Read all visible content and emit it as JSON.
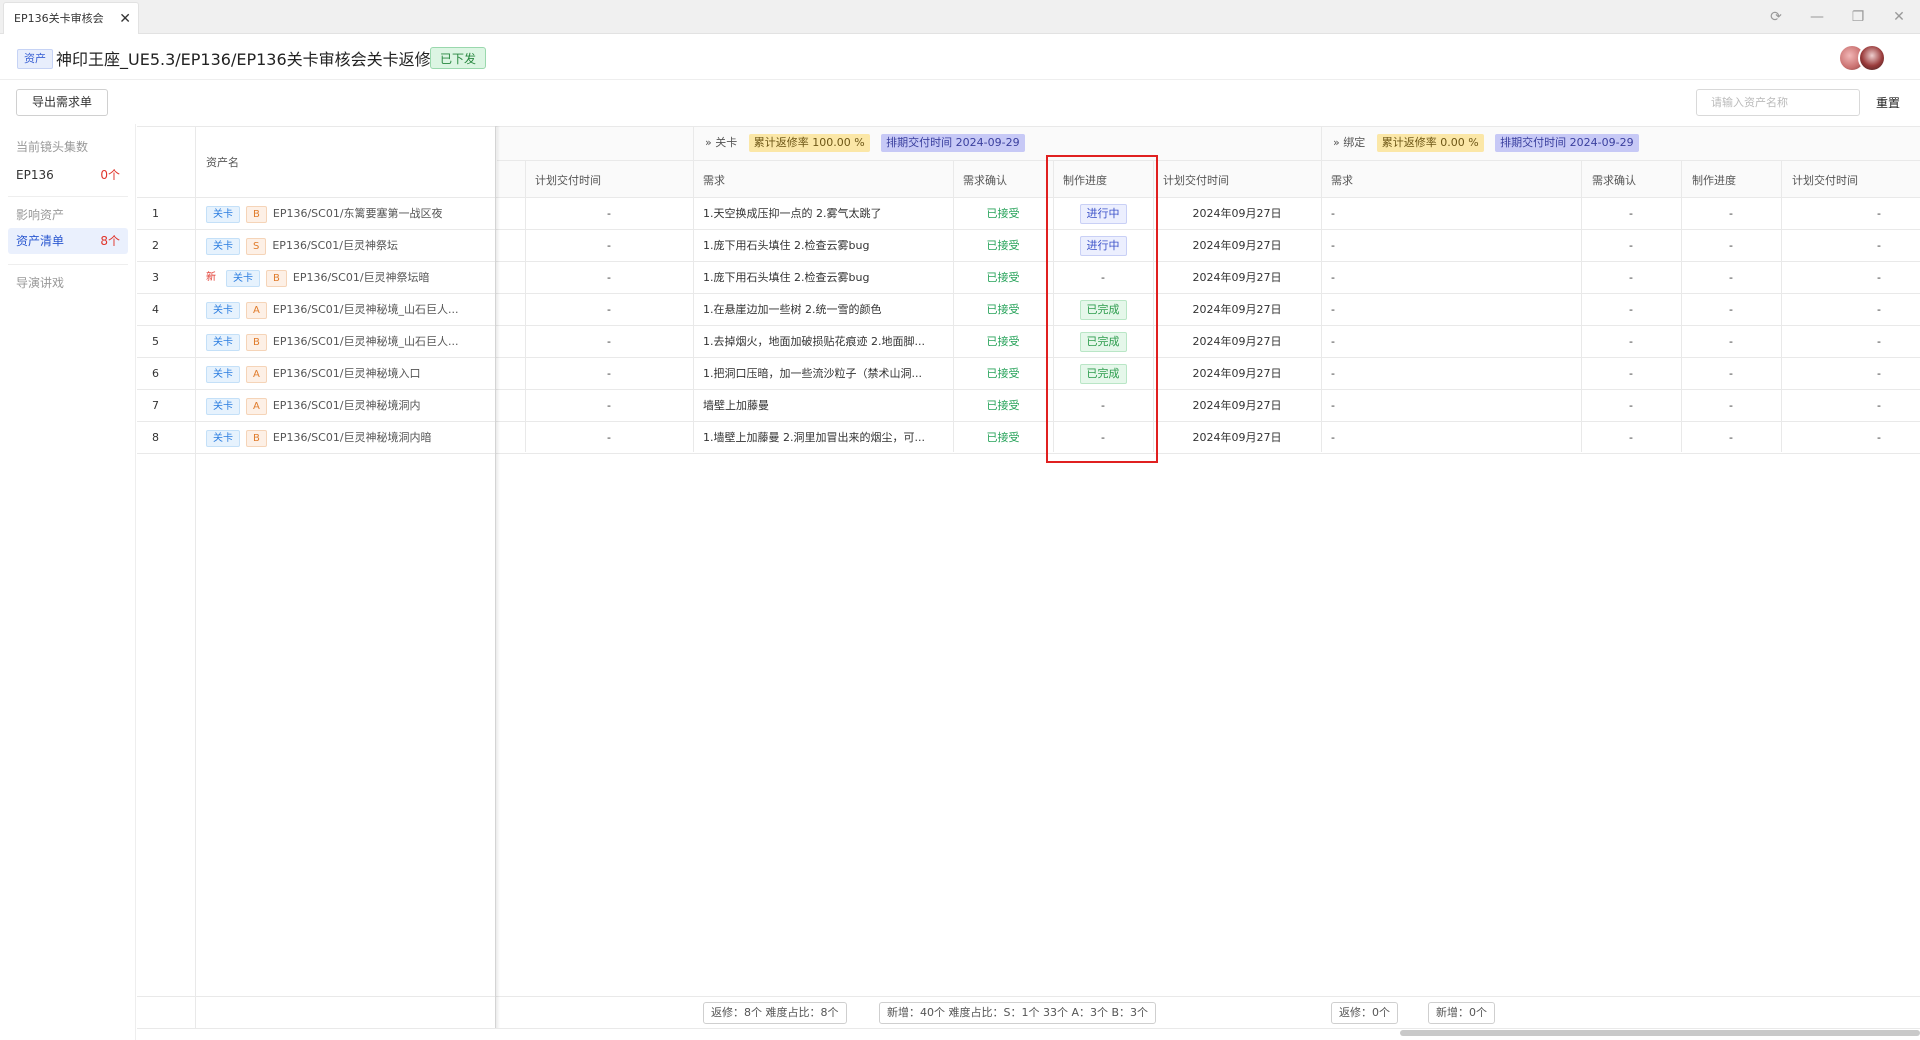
{
  "tab": {
    "label": "EP136关卡审核会",
    "close": "✕"
  },
  "window": {
    "refresh": "⟳",
    "minimize": "—",
    "restore": "❐",
    "close": "✕"
  },
  "header": {
    "asset_tag": "资产",
    "title": "神印王座_UE5.3/EP136/EP136关卡审核会关卡返修",
    "status": "已下发"
  },
  "toolbar": {
    "export_label": "导出需求单",
    "search_placeholder": "请输入资产名称",
    "reset_label": "重置"
  },
  "sidebar": {
    "group1_label": "当前镜头集数",
    "episode": {
      "label": "EP136",
      "count": "0个"
    },
    "group2_label": "影响资产",
    "asset_list": {
      "label": "资产清单",
      "count": "8个"
    },
    "group3_label": "导演讲戏"
  },
  "table": {
    "asset_name_header": "资产名",
    "plan_time_header": "计划交付时间",
    "section_level": {
      "name": "关卡",
      "rate": "累计返修率 100.00 %",
      "schedule": "排期交付时间 2024-09-29",
      "col_requirement": "需求",
      "col_confirm": "需求确认",
      "col_progress": "制作进度",
      "col_plan_time": "计划交付时间"
    },
    "section_binding": {
      "name": "绑定",
      "rate": "累计返修率 0.00 %",
      "schedule": "排期交付时间 2024-09-29",
      "col_requirement": "需求",
      "col_confirm": "需求确认",
      "col_progress": "制作进度",
      "col_plan_time": "计划交付时间"
    },
    "rows": [
      {
        "index": "1",
        "is_new": "",
        "type": "关卡",
        "grade": "B",
        "path": "EP136/SC01/东篱要塞第一战区夜",
        "prev_plan": "-",
        "requirement": "1.天空换成压抑一点的 2.雾气太跳了",
        "confirm": "已接受",
        "progress": "进行中",
        "plan_time": "2024年09月27日",
        "b_req": "-",
        "b_confirm": "-",
        "b_progress": "-",
        "b_plan": "-"
      },
      {
        "index": "2",
        "is_new": "",
        "type": "关卡",
        "grade": "S",
        "path": "EP136/SC01/巨灵神祭坛",
        "prev_plan": "-",
        "requirement": "1.庞下用石头填住 2.检查云雾bug",
        "confirm": "已接受",
        "progress": "进行中",
        "plan_time": "2024年09月27日",
        "b_req": "-",
        "b_confirm": "-",
        "b_progress": "-",
        "b_plan": "-"
      },
      {
        "index": "3",
        "is_new": "新",
        "type": "关卡",
        "grade": "B",
        "path": "EP136/SC01/巨灵神祭坛暗",
        "prev_plan": "-",
        "requirement": "1.庞下用石头填住 2.检查云雾bug",
        "confirm": "已接受",
        "progress": "-",
        "plan_time": "2024年09月27日",
        "b_req": "-",
        "b_confirm": "-",
        "b_progress": "-",
        "b_plan": "-"
      },
      {
        "index": "4",
        "is_new": "",
        "type": "关卡",
        "grade": "A",
        "path": "EP136/SC01/巨灵神秘境_山石巨人...",
        "prev_plan": "-",
        "requirement": "1.在悬崖边加一些树 2.统一雪的颜色",
        "confirm": "已接受",
        "progress": "已完成",
        "plan_time": "2024年09月27日",
        "b_req": "-",
        "b_confirm": "-",
        "b_progress": "-",
        "b_plan": "-"
      },
      {
        "index": "5",
        "is_new": "",
        "type": "关卡",
        "grade": "B",
        "path": "EP136/SC01/巨灵神秘境_山石巨人...",
        "prev_plan": "-",
        "requirement": "1.去掉烟火，地面加破损贴花痕迹 2.地面脚...",
        "confirm": "已接受",
        "progress": "已完成",
        "plan_time": "2024年09月27日",
        "b_req": "-",
        "b_confirm": "-",
        "b_progress": "-",
        "b_plan": "-"
      },
      {
        "index": "6",
        "is_new": "",
        "type": "关卡",
        "grade": "A",
        "path": "EP136/SC01/巨灵神秘境入口",
        "prev_plan": "-",
        "requirement": "1.把洞口压暗，加一些流沙粒子（禁术山洞...",
        "confirm": "已接受",
        "progress": "已完成",
        "plan_time": "2024年09月27日",
        "b_req": "-",
        "b_confirm": "-",
        "b_progress": "-",
        "b_plan": "-"
      },
      {
        "index": "7",
        "is_new": "",
        "type": "关卡",
        "grade": "A",
        "path": "EP136/SC01/巨灵神秘境洞内",
        "prev_plan": "-",
        "requirement": "墙壁上加藤曼",
        "confirm": "已接受",
        "progress": "-",
        "plan_time": "2024年09月27日",
        "b_req": "-",
        "b_confirm": "-",
        "b_progress": "-",
        "b_plan": "-"
      },
      {
        "index": "8",
        "is_new": "",
        "type": "关卡",
        "grade": "B",
        "path": "EP136/SC01/巨灵神秘境洞内暗",
        "prev_plan": "-",
        "requirement": "1.墙壁上加藤曼 2.洞里加冒出来的烟尘，可...",
        "confirm": "已接受",
        "progress": "-",
        "plan_time": "2024年09月27日",
        "b_req": "-",
        "b_confirm": "-",
        "b_progress": "-",
        "b_plan": "-"
      }
    ],
    "footer": {
      "level_rework": "返修：8个  难度占比：8个",
      "level_new": "新增：40个  难度占比：S：1个 33个 A：3个 B：3个",
      "binding_rework": "返修：0个",
      "binding_new": "新增：0个"
    }
  },
  "colors": {
    "accent": "#3b62d4",
    "accepted": "#27a35a",
    "progress_badge": "#3d53c9",
    "done_badge": "#2d9c4d",
    "highlight": "#e02020",
    "count_red": "#e0352b"
  }
}
